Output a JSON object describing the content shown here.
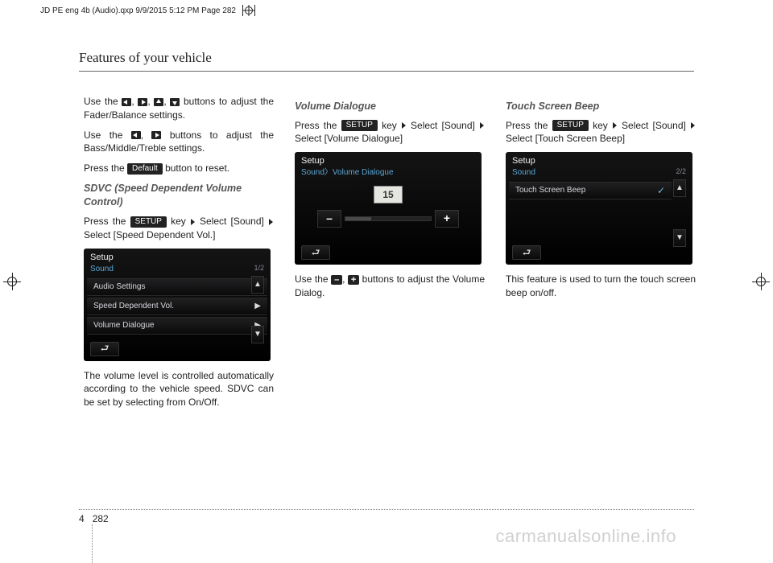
{
  "print_header": "JD PE eng 4b (Audio).qxp  9/9/2015  5:12 PM  Page 282",
  "section_title": "Features of your vehicle",
  "col1": {
    "p1a": "Use the ",
    "p1b": " buttons to adjust the Fader/Balance settings.",
    "p2a": "Use the ",
    "p2b": " buttons to adjust the Bass/Middle/Treble settings.",
    "p3a": "Press the ",
    "p3_btn": "Default",
    "p3b": " button to reset.",
    "sub1": "SDVC (Speed Dependent Volume Control)",
    "p4a": "Press the ",
    "p4_btn": "SETUP",
    "p4b": " key",
    "p4c": "Select [Sound]",
    "p4d": "Select [Speed Dependent Vol.]",
    "screen": {
      "title": "Setup",
      "subtitle": "Sound",
      "page": "1/2",
      "items": [
        "Audio Settings",
        "Speed Dependent Vol.",
        "Volume Dialogue"
      ]
    },
    "p5": "The volume level is controlled automatically according to the vehicle speed. SDVC can be set by selecting from On/Off."
  },
  "col2": {
    "sub": "Volume Dialogue",
    "p1a": "Press the ",
    "p1_btn": "SETUP",
    "p1b": " key",
    "p1c": "Select [Sound]",
    "p1d": "Select [Volume Dialogue]",
    "screen": {
      "title": "Setup",
      "subtitle": "Sound〉Volume Dialogue",
      "value": "15"
    },
    "p2a": "Use the ",
    "p2b": " buttons to adjust the Volume Dialog."
  },
  "col3": {
    "sub": "Touch Screen Beep",
    "p1a": "Press the ",
    "p1_btn": "SETUP",
    "p1b": " key",
    "p1c": "Select [Sound]",
    "p1d": "Select [Touch Screen Beep]",
    "screen": {
      "title": "Setup",
      "subtitle": "Sound",
      "page": "2/2",
      "items": [
        "Touch Screen Beep"
      ]
    },
    "p2": "This feature is used to turn the touch screen beep on/off."
  },
  "footer": {
    "chapter": "4",
    "page": "282"
  },
  "watermark": "carmanualsonline.info",
  "icons": {
    "minus": "–",
    "plus": "+"
  }
}
